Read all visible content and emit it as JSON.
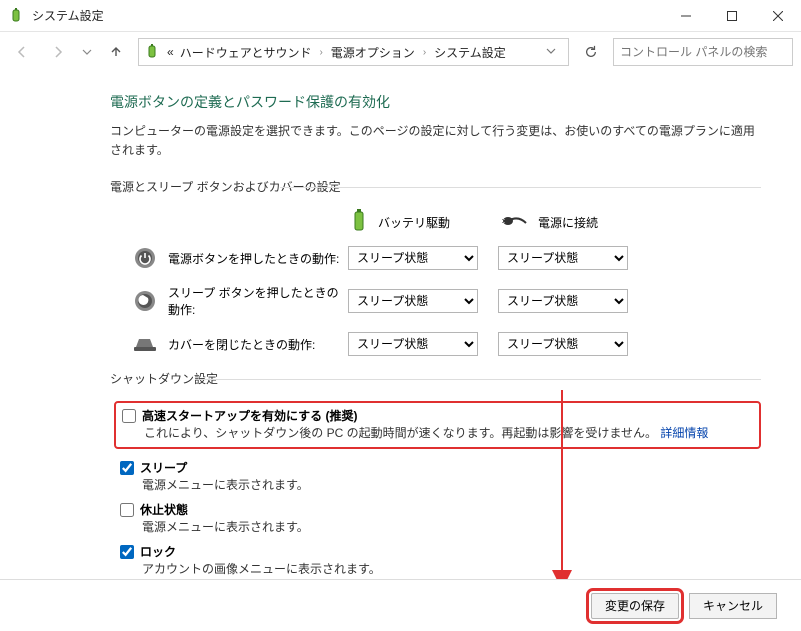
{
  "window": {
    "title": "システム設定"
  },
  "breadcrumbs": {
    "prefix": "«",
    "items": [
      "ハードウェアとサウンド",
      "電源オプション",
      "システム設定"
    ]
  },
  "search": {
    "placeholder": "コントロール パネルの検索"
  },
  "page": {
    "title": "電源ボタンの定義とパスワード保護の有効化",
    "description": "コンピューターの電源設定を選択できます。このページの設定に対して行う変更は、お使いのすべての電源プランに適用されます。"
  },
  "group1": {
    "label": "電源とスリープ ボタンおよびカバーの設定",
    "col_battery": "バッテリ駆動",
    "col_plugged": "電源に接続",
    "rows": [
      {
        "label": "電源ボタンを押したときの動作:",
        "battery": "スリープ状態",
        "plugged": "スリープ状態"
      },
      {
        "label": "スリープ ボタンを押したときの動作:",
        "battery": "スリープ状態",
        "plugged": "スリープ状態"
      },
      {
        "label": "カバーを閉じたときの動作:",
        "battery": "スリープ状態",
        "plugged": "スリープ状態"
      }
    ]
  },
  "group2": {
    "label": "シャットダウン設定",
    "items": [
      {
        "checked": false,
        "label": "高速スタートアップを有効にする (推奨)",
        "desc_a": "これにより、シャットダウン後の PC の起動時間が速くなります。再起動は影響を受けません。",
        "link": "詳細情報"
      },
      {
        "checked": true,
        "label": "スリープ",
        "desc": "電源メニューに表示されます。"
      },
      {
        "checked": false,
        "label": "休止状態",
        "desc": "電源メニューに表示されます。"
      },
      {
        "checked": true,
        "label": "ロック",
        "desc": "アカウントの画像メニューに表示されます。"
      }
    ]
  },
  "footer": {
    "save": "変更の保存",
    "cancel": "キャンセル"
  }
}
